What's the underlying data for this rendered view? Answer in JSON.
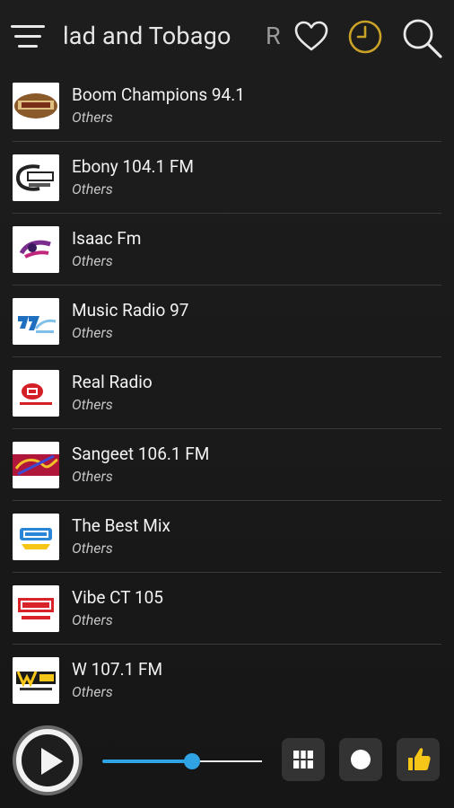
{
  "header": {
    "title": "Trinidad and Tobago",
    "next_title": "R",
    "colors": {
      "clock_accent": "#c9a227",
      "icon": "#e8e8e8"
    }
  },
  "stations": [
    {
      "name": "Boom Champions 94.1",
      "genre": "Others",
      "logo_icon": "boom-champions-logo"
    },
    {
      "name": "Ebony 104.1 FM",
      "genre": "Others",
      "logo_icon": "ebony-104-logo"
    },
    {
      "name": "Isaac Fm",
      "genre": "Others",
      "logo_icon": "isaac-fm-logo"
    },
    {
      "name": "Music Radio 97",
      "genre": "Others",
      "logo_icon": "music-radio-97-logo"
    },
    {
      "name": "Real Radio",
      "genre": "Others",
      "logo_icon": "real-radio-logo"
    },
    {
      "name": "Sangeet 106.1 FM",
      "genre": "Others",
      "logo_icon": "sangeet-logo"
    },
    {
      "name": "The Best Mix",
      "genre": "Others",
      "logo_icon": "best-mix-logo"
    },
    {
      "name": "Vibe CT 105",
      "genre": "Others",
      "logo_icon": "vibe-ct-logo"
    },
    {
      "name": "W 107.1 FM",
      "genre": "Others",
      "logo_icon": "w-107-logo"
    }
  ],
  "player": {
    "volume_fraction": 0.56,
    "colors": {
      "accent": "#2fa3e3",
      "like": "#f5c518"
    }
  }
}
